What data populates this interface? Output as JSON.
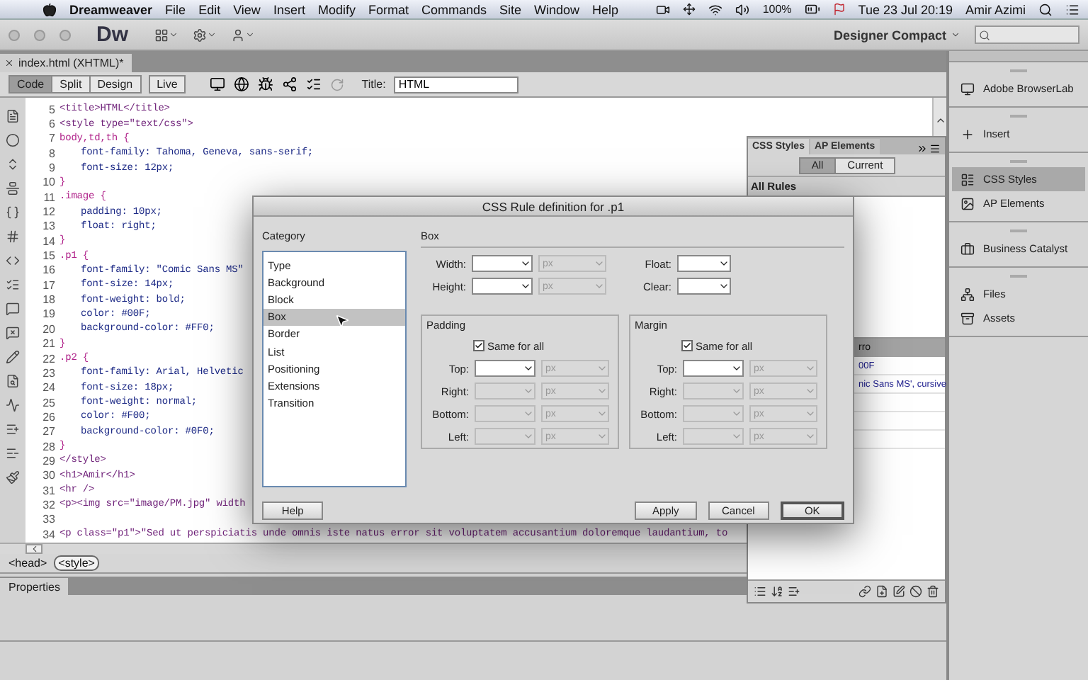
{
  "menu_bar": {
    "app": "Dreamweaver",
    "items": [
      "File",
      "Edit",
      "View",
      "Insert",
      "Modify",
      "Format",
      "Commands",
      "Site",
      "Window",
      "Help"
    ],
    "battery": "100%",
    "clock": "Tue 23 Jul 20:19",
    "user": "Amir Azimi"
  },
  "app_toolbar": {
    "logo": "Dw",
    "workspace": "Designer Compact"
  },
  "document_tab": {
    "title": "index.html (XHTML)*"
  },
  "document_toolbar": {
    "views": [
      {
        "label": "Code",
        "selected": true
      },
      {
        "label": "Split",
        "selected": false
      },
      {
        "label": "Design",
        "selected": false
      },
      {
        "label": "Live",
        "selected": false
      }
    ],
    "title_label": "Title:",
    "title_value": "HTML"
  },
  "code": {
    "lines": [
      {
        "number": "5",
        "kind": "tag",
        "text": "<title>HTML</title>"
      },
      {
        "number": "6",
        "kind": "tag",
        "text": "<style type=\"text/css\">"
      },
      {
        "number": "7",
        "kind": "selector",
        "text": "body,td,th {"
      },
      {
        "number": "8",
        "kind": "declaration",
        "text": "font-family: Tahoma, Geneva, sans-serif;"
      },
      {
        "number": "9",
        "kind": "declaration",
        "text": "font-size: 12px;"
      },
      {
        "number": "10",
        "kind": "selector",
        "text": "}"
      },
      {
        "number": "11",
        "kind": "selector",
        "text": ".image {"
      },
      {
        "number": "12",
        "kind": "declaration",
        "text": "padding: 10px;"
      },
      {
        "number": "13",
        "kind": "declaration",
        "text": "float: right;"
      },
      {
        "number": "14",
        "kind": "selector",
        "text": "}"
      },
      {
        "number": "15",
        "kind": "selector",
        "text": ".p1 {"
      },
      {
        "number": "16",
        "kind": "declaration",
        "text": "font-family: \"Comic Sans MS\""
      },
      {
        "number": "17",
        "kind": "declaration",
        "text": "font-size: 14px;"
      },
      {
        "number": "18",
        "kind": "declaration",
        "text": "font-weight: bold;"
      },
      {
        "number": "19",
        "kind": "declaration",
        "text": "color: #00F;"
      },
      {
        "number": "20",
        "kind": "declaration",
        "text": "background-color: #FF0;"
      },
      {
        "number": "21",
        "kind": "selector",
        "text": "}"
      },
      {
        "number": "22",
        "kind": "selector",
        "text": ".p2 {"
      },
      {
        "number": "23",
        "kind": "declaration",
        "text": "font-family: Arial, Helvetic"
      },
      {
        "number": "24",
        "kind": "declaration",
        "text": "font-size: 18px;"
      },
      {
        "number": "25",
        "kind": "declaration",
        "text": "font-weight: normal;"
      },
      {
        "number": "26",
        "kind": "declaration",
        "text": "color: #F00;"
      },
      {
        "number": "27",
        "kind": "declaration",
        "text": "background-color: #0F0;"
      },
      {
        "number": "28",
        "kind": "selector",
        "text": "}"
      },
      {
        "number": "29",
        "kind": "tag",
        "text": "</style>"
      },
      {
        "number": "30",
        "kind": "tag",
        "text": "<h1>Amir</h1>"
      },
      {
        "number": "31",
        "kind": "tag",
        "text": "<hr />"
      },
      {
        "number": "32",
        "kind": "tag",
        "text": "<p><img src=\"image/PM.jpg\" width"
      },
      {
        "number": "33",
        "kind": "blank"
      },
      {
        "number": "34",
        "kind": "tag",
        "text": "<p class=\"p1\">\"Sed ut perspiciatis unde omnis iste natus error sit voluptatem accusantium doloremque laudantium, to"
      }
    ]
  },
  "tag_selector": [
    {
      "label": "<head>",
      "selected": false
    },
    {
      "label": "<style>",
      "selected": true
    }
  ],
  "properties_panel": {
    "title": "Properties"
  },
  "css_panel": {
    "tabs": [
      {
        "label": "CSS Styles",
        "selected": true
      },
      {
        "label": "AP Elements",
        "selected": false
      }
    ],
    "modes": [
      {
        "label": "All",
        "selected": true
      },
      {
        "label": "Current",
        "selected": false
      }
    ],
    "section": "All Rules",
    "properties_header": "rro",
    "property_values": [
      "00F",
      "nic Sans MS', cursive"
    ]
  },
  "dock": {
    "groups": [
      {
        "items": [
          {
            "label": "Adobe BrowserLab",
            "selected": false
          }
        ]
      },
      {
        "items": [
          {
            "label": "Insert",
            "selected": false
          }
        ]
      },
      {
        "items": [
          {
            "label": "CSS Styles",
            "selected": true
          },
          {
            "label": "AP Elements",
            "selected": false
          }
        ]
      },
      {
        "items": [
          {
            "label": "Business Catalyst",
            "selected": false
          }
        ]
      },
      {
        "items": [
          {
            "label": "Files",
            "selected": false
          },
          {
            "label": "Assets",
            "selected": false
          }
        ]
      }
    ]
  },
  "dialog": {
    "title": "CSS Rule definition for .p1",
    "category_label": "Category",
    "categories": [
      {
        "label": "Type",
        "selected": false
      },
      {
        "label": "Background",
        "selected": false
      },
      {
        "label": "Block",
        "selected": false
      },
      {
        "label": "Box",
        "selected": true
      },
      {
        "label": "Border",
        "selected": false
      },
      {
        "label": "List",
        "selected": false
      },
      {
        "label": "Positioning",
        "selected": false
      },
      {
        "label": "Extensions",
        "selected": false
      },
      {
        "label": "Transition",
        "selected": false
      }
    ],
    "section": "Box",
    "size_fields": [
      {
        "label": "Width:",
        "unit": "px",
        "unit_disabled": true
      },
      {
        "label": "Height:",
        "unit": "px",
        "unit_disabled": true
      }
    ],
    "float_fields": [
      {
        "label": "Float:"
      },
      {
        "label": "Clear:"
      }
    ],
    "groups": [
      {
        "title": "Padding",
        "same_for_all": {
          "label": "Same for all",
          "checked": true
        },
        "fields": [
          {
            "label": "Top:",
            "disabled": false,
            "unit": "px"
          },
          {
            "label": "Right:",
            "disabled": true,
            "unit": "px"
          },
          {
            "label": "Bottom:",
            "disabled": true,
            "unit": "px"
          },
          {
            "label": "Left:",
            "disabled": true,
            "unit": "px"
          }
        ]
      },
      {
        "title": "Margin",
        "same_for_all": {
          "label": "Same for all",
          "checked": true
        },
        "fields": [
          {
            "label": "Top:",
            "disabled": false,
            "unit": "px"
          },
          {
            "label": "Right:",
            "disabled": true,
            "unit": "px"
          },
          {
            "label": "Bottom:",
            "disabled": true,
            "unit": "px"
          },
          {
            "label": "Left:",
            "disabled": true,
            "unit": "px"
          }
        ]
      }
    ],
    "buttons": [
      {
        "label": "Help",
        "kind": "help"
      },
      {
        "label": "Apply",
        "kind": "normal"
      },
      {
        "label": "Cancel",
        "kind": "normal"
      },
      {
        "label": "OK",
        "kind": "default"
      }
    ]
  }
}
